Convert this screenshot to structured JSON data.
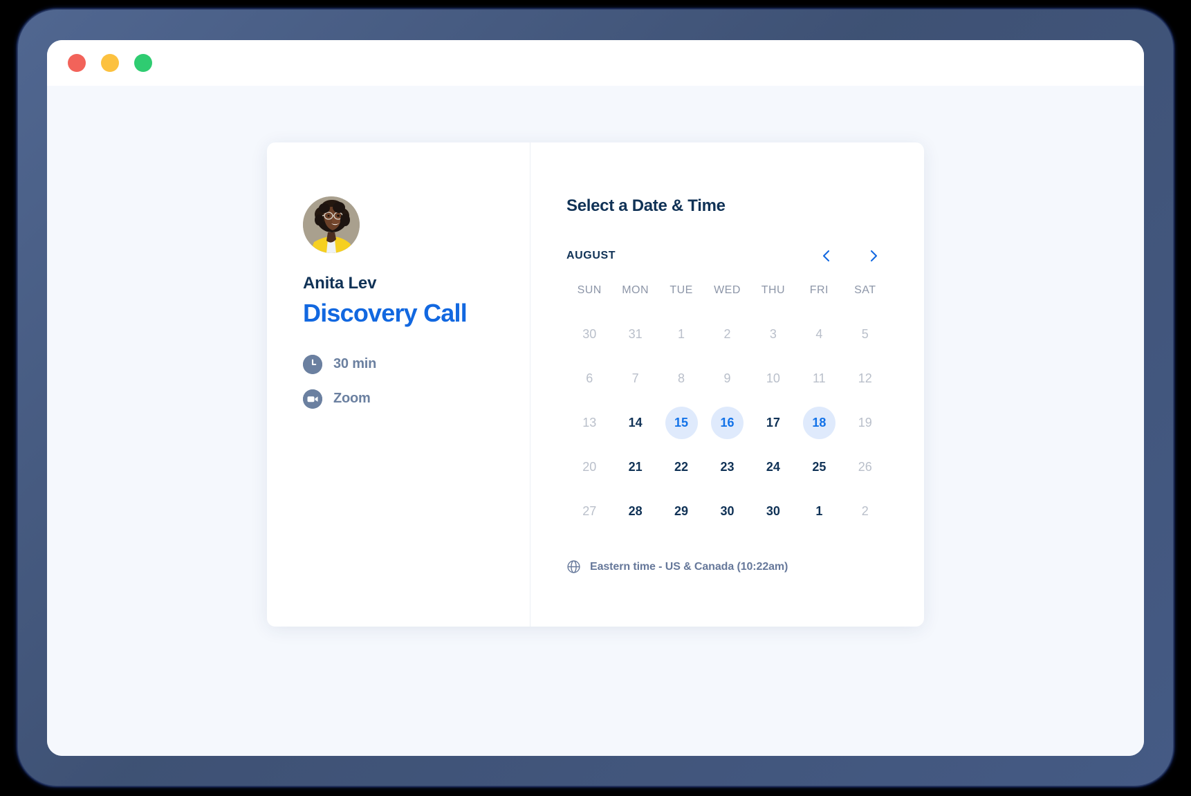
{
  "window": {
    "traffic_lights": [
      {
        "name": "close",
        "color": "#f2635a"
      },
      {
        "name": "minimize",
        "color": "#fcc13f"
      },
      {
        "name": "maximize",
        "color": "#2fcc71"
      }
    ]
  },
  "booking": {
    "host_name": "Anita Lev",
    "event_title": "Discovery Call",
    "meta": [
      {
        "icon": "clock-icon",
        "label": "30 min"
      },
      {
        "icon": "video-camera-icon",
        "label": "Zoom"
      }
    ]
  },
  "calendar": {
    "heading": "Select a Date & Time",
    "month": "AUGUST",
    "prev_icon": "chevron-left-icon",
    "next_icon": "chevron-right-icon",
    "weekdays": [
      "SUN",
      "MON",
      "TUE",
      "WED",
      "THU",
      "FRI",
      "SAT"
    ],
    "weeks": [
      [
        {
          "day": "30",
          "state": "disabled"
        },
        {
          "day": "31",
          "state": "disabled"
        },
        {
          "day": "1",
          "state": "disabled"
        },
        {
          "day": "2",
          "state": "disabled"
        },
        {
          "day": "3",
          "state": "disabled"
        },
        {
          "day": "4",
          "state": "disabled"
        },
        {
          "day": "5",
          "state": "disabled"
        }
      ],
      [
        {
          "day": "6",
          "state": "disabled"
        },
        {
          "day": "7",
          "state": "disabled"
        },
        {
          "day": "8",
          "state": "disabled"
        },
        {
          "day": "9",
          "state": "disabled"
        },
        {
          "day": "10",
          "state": "disabled"
        },
        {
          "day": "11",
          "state": "disabled"
        },
        {
          "day": "12",
          "state": "disabled"
        }
      ],
      [
        {
          "day": "13",
          "state": "disabled"
        },
        {
          "day": "14",
          "state": "available"
        },
        {
          "day": "15",
          "state": "selectable"
        },
        {
          "day": "16",
          "state": "selectable"
        },
        {
          "day": "17",
          "state": "available"
        },
        {
          "day": "18",
          "state": "selectable"
        },
        {
          "day": "19",
          "state": "disabled"
        }
      ],
      [
        {
          "day": "20",
          "state": "disabled"
        },
        {
          "day": "21",
          "state": "available"
        },
        {
          "day": "22",
          "state": "available"
        },
        {
          "day": "23",
          "state": "available"
        },
        {
          "day": "24",
          "state": "available"
        },
        {
          "day": "25",
          "state": "available"
        },
        {
          "day": "26",
          "state": "disabled"
        }
      ],
      [
        {
          "day": "27",
          "state": "disabled"
        },
        {
          "day": "28",
          "state": "available"
        },
        {
          "day": "29",
          "state": "available"
        },
        {
          "day": "30",
          "state": "available"
        },
        {
          "day": "30",
          "state": "available"
        },
        {
          "day": "1",
          "state": "available"
        },
        {
          "day": "2",
          "state": "disabled"
        }
      ]
    ],
    "timezone": {
      "icon": "globe-icon",
      "label": "Eastern time - US & Canada (10:22am)"
    }
  },
  "colors": {
    "accent_blue": "#1268e0",
    "selected_bg": "#dfeafc",
    "text_dark": "#103256",
    "text_muted": "#6b80a0",
    "text_disabled": "#b9bfca",
    "page_bg": "#f5f8fd",
    "bezel": "#3f5274"
  }
}
